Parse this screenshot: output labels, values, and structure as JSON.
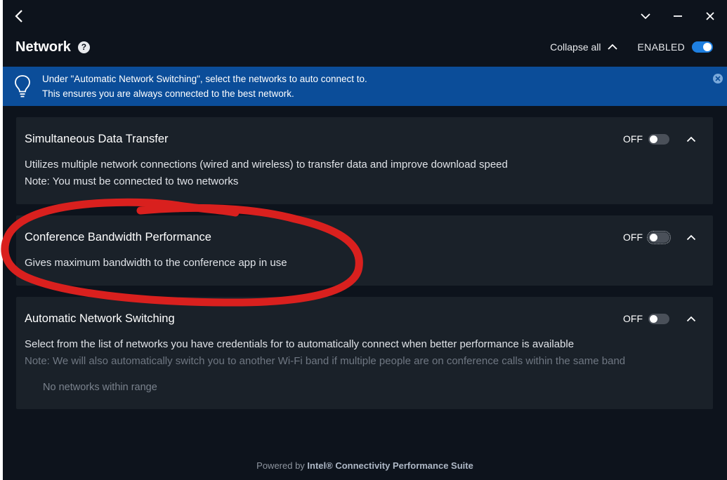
{
  "header": {
    "title": "Network",
    "collapse_all": "Collapse all",
    "enabled_label": "ENABLED"
  },
  "banner": {
    "line1": "Under \"Automatic Network Switching\", select the networks to auto connect to.",
    "line2": "This ensures you are always connected to the best network."
  },
  "cards": [
    {
      "title": "Simultaneous Data Transfer",
      "state": "OFF",
      "desc1": "Utilizes multiple network connections (wired and wireless) to transfer data and improve download speed",
      "desc2": "Note: You must be connected to two networks"
    },
    {
      "title": "Conference Bandwidth Performance",
      "state": "OFF",
      "desc1": "Gives maximum bandwidth to the conference app in use"
    },
    {
      "title": "Automatic Network Switching",
      "state": "OFF",
      "desc1": "Select from the list of networks you have credentials for to automatically connect when better performance is available",
      "desc2": "Note: We will also automatically switch you to another Wi-Fi band if multiple people are on conference calls within the same band",
      "empty_text": "No networks within range"
    }
  ],
  "footer": {
    "powered_by": "Powered by ",
    "brand": "Intel® Connectivity Performance Suite"
  },
  "colors": {
    "background": "#0d131c",
    "card": "#1a2129",
    "banner": "#0b4d99",
    "accent": "#1e7fe0",
    "annotation": "#d9201e"
  },
  "icons": [
    "back-arrow-icon",
    "chevron-down-icon",
    "minimize-icon",
    "close-icon",
    "help-icon",
    "chevron-up-icon",
    "lightbulb-icon"
  ]
}
